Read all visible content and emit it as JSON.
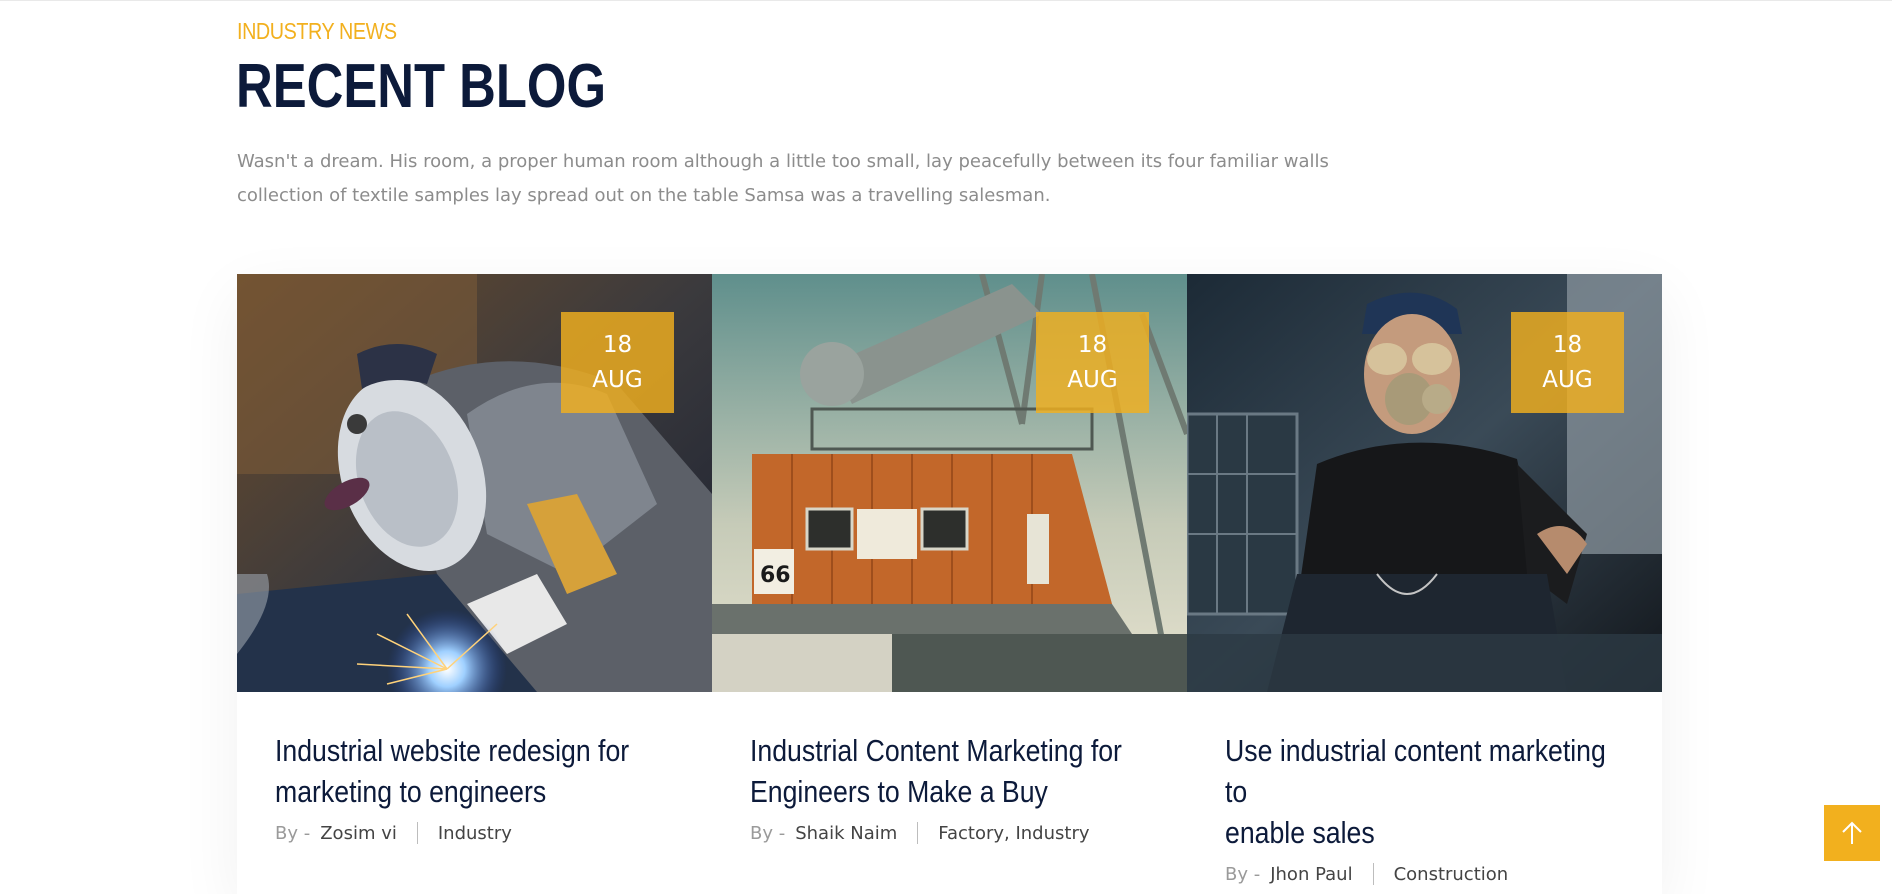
{
  "section": {
    "kicker": "INDUSTRY NEWS",
    "title": "RECENT BLOG",
    "intro_line1": "Wasn't a dream. His room, a proper human room although a little too small, lay peacefully between its four familiar walls",
    "intro_line2": "collection of textile samples lay spread out on the table Samsa was a travelling salesman."
  },
  "posts": [
    {
      "day": "18",
      "month": "AUG",
      "title_line1": "Industrial website redesign for",
      "title_line2": "marketing to engineers",
      "by_prefix": "By -",
      "author": "Zosim vi",
      "categories": "Industry"
    },
    {
      "day": "18",
      "month": "AUG",
      "title_line1": "Industrial Content Marketing for",
      "title_line2": "Engineers to Make a Buy",
      "by_prefix": "By -",
      "author": "Shaik Naim",
      "categories": "Factory, Industry"
    },
    {
      "day": "18",
      "month": "AUG",
      "title_line1": "Use industrial content marketing to",
      "title_line2": "enable sales",
      "by_prefix": "By -",
      "author": "Jhon Paul",
      "categories": "Construction"
    }
  ],
  "scroll_top": {
    "icon": "arrow-up-icon"
  },
  "colors": {
    "accent": "#f2b01e",
    "heading": "#0c1a3a",
    "body_text": "#8c8c8c"
  }
}
